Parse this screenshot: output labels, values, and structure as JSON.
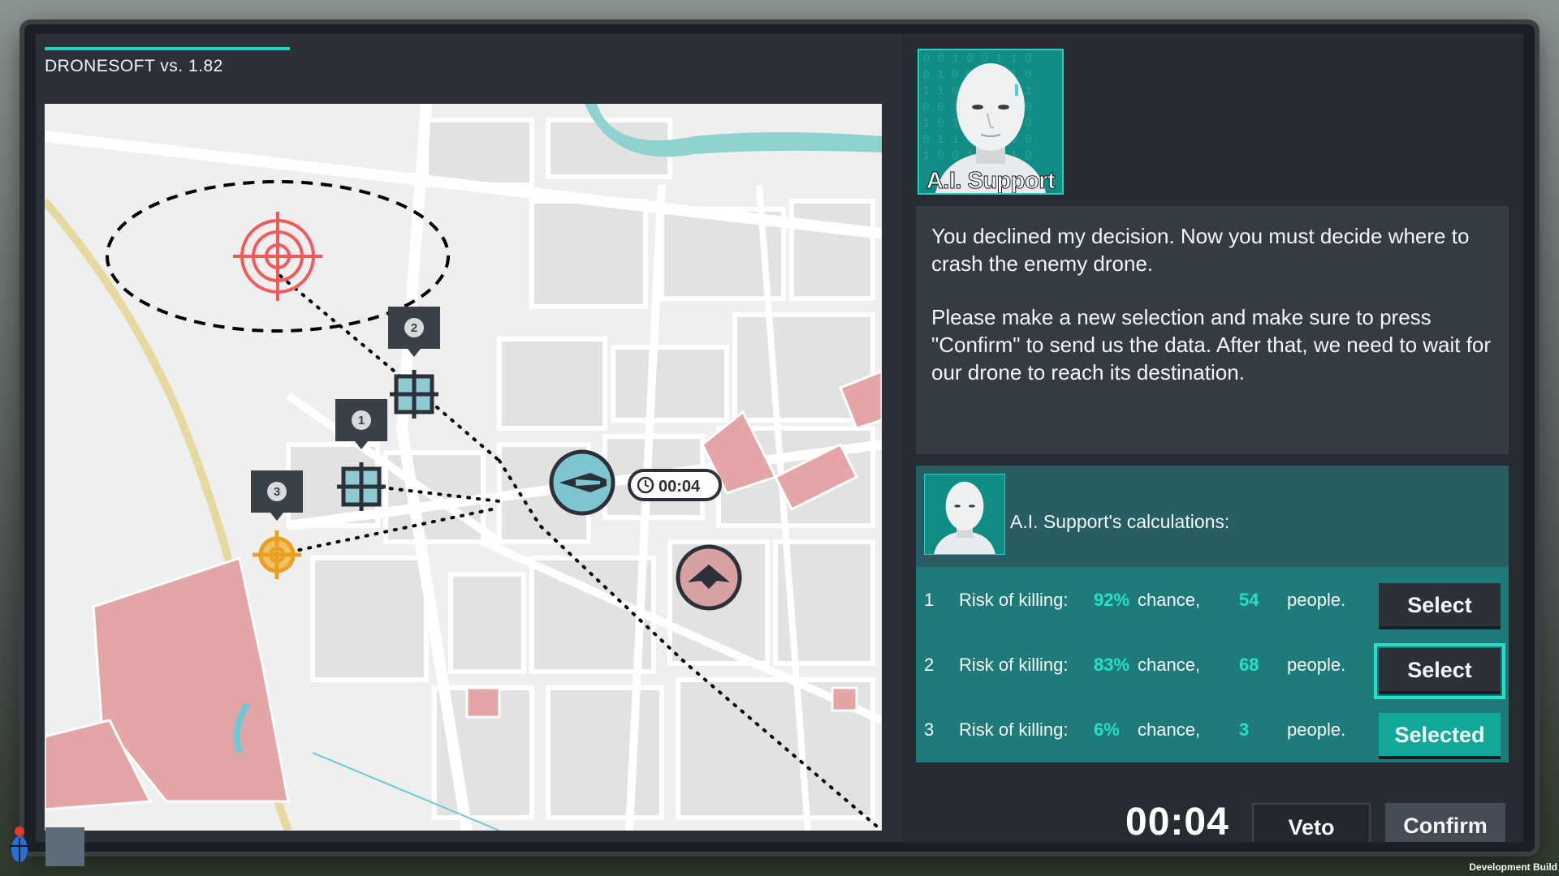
{
  "app": {
    "title": "DRONESOFT vs. 1.82"
  },
  "ai_support": {
    "label": "A.I. Support",
    "message_1": "You declined my decision. Now you must decide where to crash the enemy drone.",
    "message_2": "Please make a new selection and make sure to press \"Confirm\" to send us the data. After that, we need to wait for our drone to reach its destination."
  },
  "calculations": {
    "title": "A.I. Support's calculations:",
    "rows": [
      {
        "num": "1",
        "risk_label": "Risk of killing:",
        "pct": "92%",
        "chance_label": "chance,",
        "people_n": "54",
        "people_label": "people.",
        "button": "Select"
      },
      {
        "num": "2",
        "risk_label": "Risk of killing:",
        "pct": "83%",
        "chance_label": "chance,",
        "people_n": "68",
        "people_label": "people.",
        "button": "Select"
      },
      {
        "num": "3",
        "risk_label": "Risk of killing:",
        "pct": "6%",
        "chance_label": "chance,",
        "people_n": "3",
        "people_label": "people.",
        "button": "Selected"
      }
    ],
    "selected_row": 3,
    "hovered_row": 2
  },
  "map": {
    "markers": [
      "1",
      "2",
      "3"
    ],
    "drone_timer": "00:04"
  },
  "controls": {
    "timer": "00:04",
    "timer_progress": 0.1,
    "veto_label": "Veto",
    "confirm_label": "Confirm"
  },
  "footer": {
    "dev_label": "Development Build"
  },
  "colors": {
    "accent": "#1fd3bf",
    "panel_teal": "#1f7b7a",
    "target_red": "#f05a5a",
    "marker_orange": "#e8a020"
  },
  "icons": [
    "target-icon",
    "crosshair-marker-icon",
    "friendly-drone-icon",
    "enemy-drone-icon",
    "clock-icon",
    "bug-icon"
  ]
}
